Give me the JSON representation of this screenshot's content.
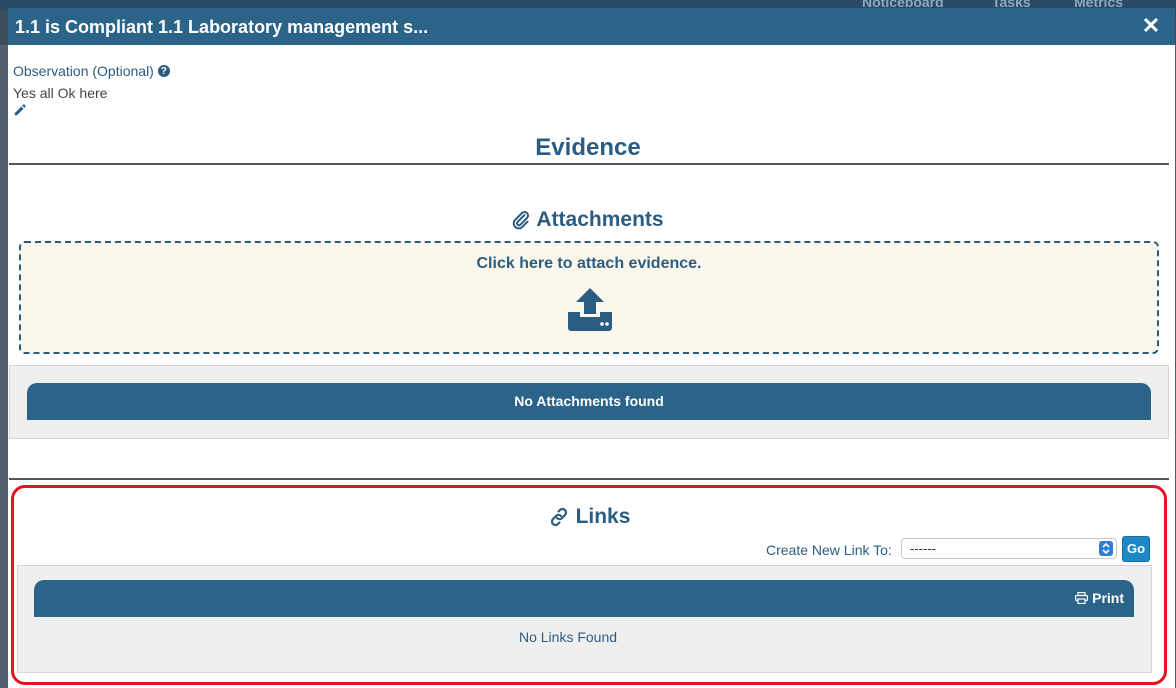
{
  "background": {
    "nav_items": [
      "Noticeboard",
      "Tasks",
      "Metrics"
    ]
  },
  "modal": {
    "title": "1.1 is Compliant 1.1 Laboratory management s...",
    "close_icon": "close-icon"
  },
  "observation": {
    "label": "Observation (Optional)",
    "help_icon": "question-circle-icon",
    "value": "Yes all Ok here",
    "edit_icon": "pencil-icon"
  },
  "evidence": {
    "title": "Evidence"
  },
  "attachments": {
    "title": "Attachments",
    "icon": "paperclip-icon",
    "dropzone_text": "Click here to attach evidence.",
    "upload_icon": "upload-icon",
    "empty_text": "No Attachments found"
  },
  "links": {
    "title": "Links",
    "icon": "link-icon",
    "create_label": "Create New Link To:",
    "select_value": "------",
    "go_label": "Go",
    "print_label": "Print",
    "print_icon": "print-icon",
    "empty_text": "No Links Found"
  },
  "colors": {
    "primary": "#2b6488",
    "text_blue": "#2b5d82",
    "highlight_border": "#e2141f",
    "dropzone_bg": "#fcf7ec"
  }
}
